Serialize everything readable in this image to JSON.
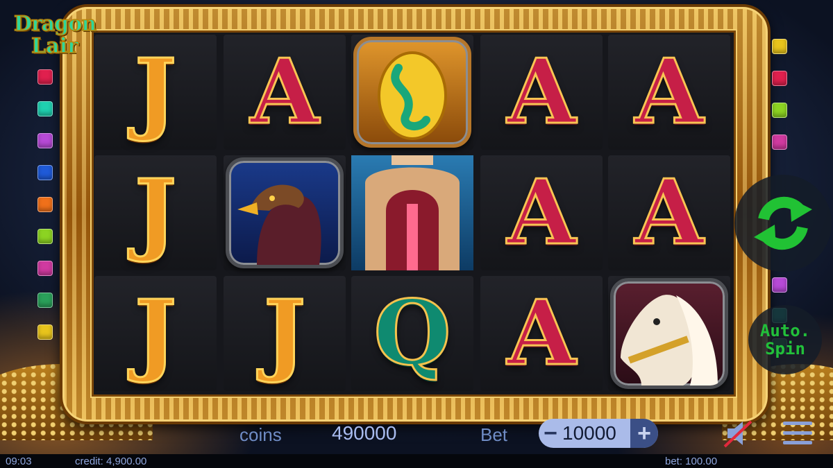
{
  "game": {
    "logo_line1": "Dragon",
    "logo_line2": "Lair"
  },
  "reels": [
    [
      "J",
      "J",
      "J"
    ],
    [
      "A",
      "eagle",
      "J"
    ],
    [
      "egg",
      "tower",
      "Q"
    ],
    [
      "A",
      "A",
      "A"
    ],
    [
      "A",
      "A",
      "horse"
    ]
  ],
  "controls": {
    "coins_label": "coins",
    "coins_value": "490000",
    "bet_label": "Bet",
    "bet_value": "10000",
    "minus_label": "−",
    "plus_label": "+",
    "auto_spin_line1": "Auto.",
    "auto_spin_line2": "Spin",
    "spin_icon": "refresh-arrows-icon",
    "sound_icon": "speaker-muted-icon",
    "menu_icon": "hamburger-menu-icon"
  },
  "status": {
    "clock": "09:03",
    "credit": "credit: 4,900.00",
    "bet": "bet: 100.00"
  },
  "colors": {
    "gold": "#e7b64b",
    "spin_green": "#22c03a",
    "hud_text": "#a9bcf0",
    "bet_pill": "#aabbe9"
  },
  "paylines_left": [
    "#e0204e",
    "#1fd0b0",
    "#b64ad6",
    "#1f5ad8",
    "#f0701a",
    "#8cd322",
    "#d03aa0",
    "#2aa05a",
    "#e8c41c"
  ],
  "paylines_right": [
    "#e8c41c",
    "#e0204e",
    "#8cd322",
    "#d03aa0",
    "#b64ad6",
    "#1fd0b0",
    "#2aa05a"
  ]
}
